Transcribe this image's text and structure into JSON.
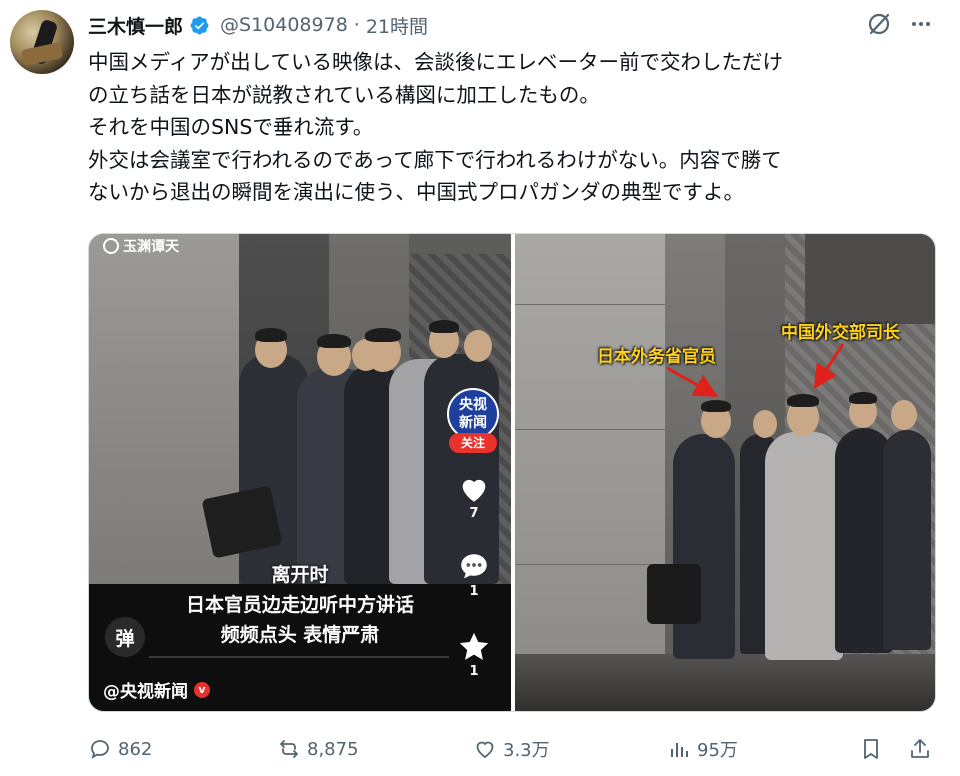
{
  "author": {
    "display_name": "三木慎一郎",
    "handle": "@S10408978",
    "separator": "·",
    "time": "21時間"
  },
  "tweet": {
    "lines": [
      "中国メディアが出している映像は、会談後にエレベーター前で交わしただけ",
      "の立ち話を日本が説教されている構図に加工したもの。",
      "それを中国のSNSで垂れ流す。",
      "外交は会議室で行われるのであって廊下で行われるわけがない。内容で勝て",
      "ないから退出の瞬間を演出に使う、中国式プロパガンダの典型ですよ。"
    ]
  },
  "media": {
    "left": {
      "watermark": "玉渊谭天",
      "caption_line1": "离开时",
      "caption_line2": "日本官员边走边听中方讲话",
      "caption_line3": "频频点头 表情严肃",
      "danmu_button": "弹",
      "source_label": "@央视新闻",
      "channel_badge_line1": "央视",
      "channel_badge_line2": "新闻",
      "follow_label": "关注",
      "like_count": "7",
      "comment_count": "1",
      "favorite_count": "1",
      "progress": 0.0
    },
    "right": {
      "annotation_japan": "日本外务省官员",
      "annotation_china": "中国外交部司长"
    }
  },
  "actions": {
    "replies": "862",
    "reposts": "8,875",
    "likes": "3.3万",
    "views": "95万"
  },
  "colors": {
    "text_primary": "#0f1419",
    "text_secondary": "#536471",
    "verified_blue": "#1d9bf0",
    "annotation_yellow": "#ffd21f",
    "arrow_red": "#e0201a"
  },
  "icons": [
    "verified-badge-icon",
    "grok-icon",
    "more-icon",
    "reply-icon",
    "repost-icon",
    "like-icon",
    "views-icon",
    "bookmark-icon",
    "share-icon"
  ]
}
